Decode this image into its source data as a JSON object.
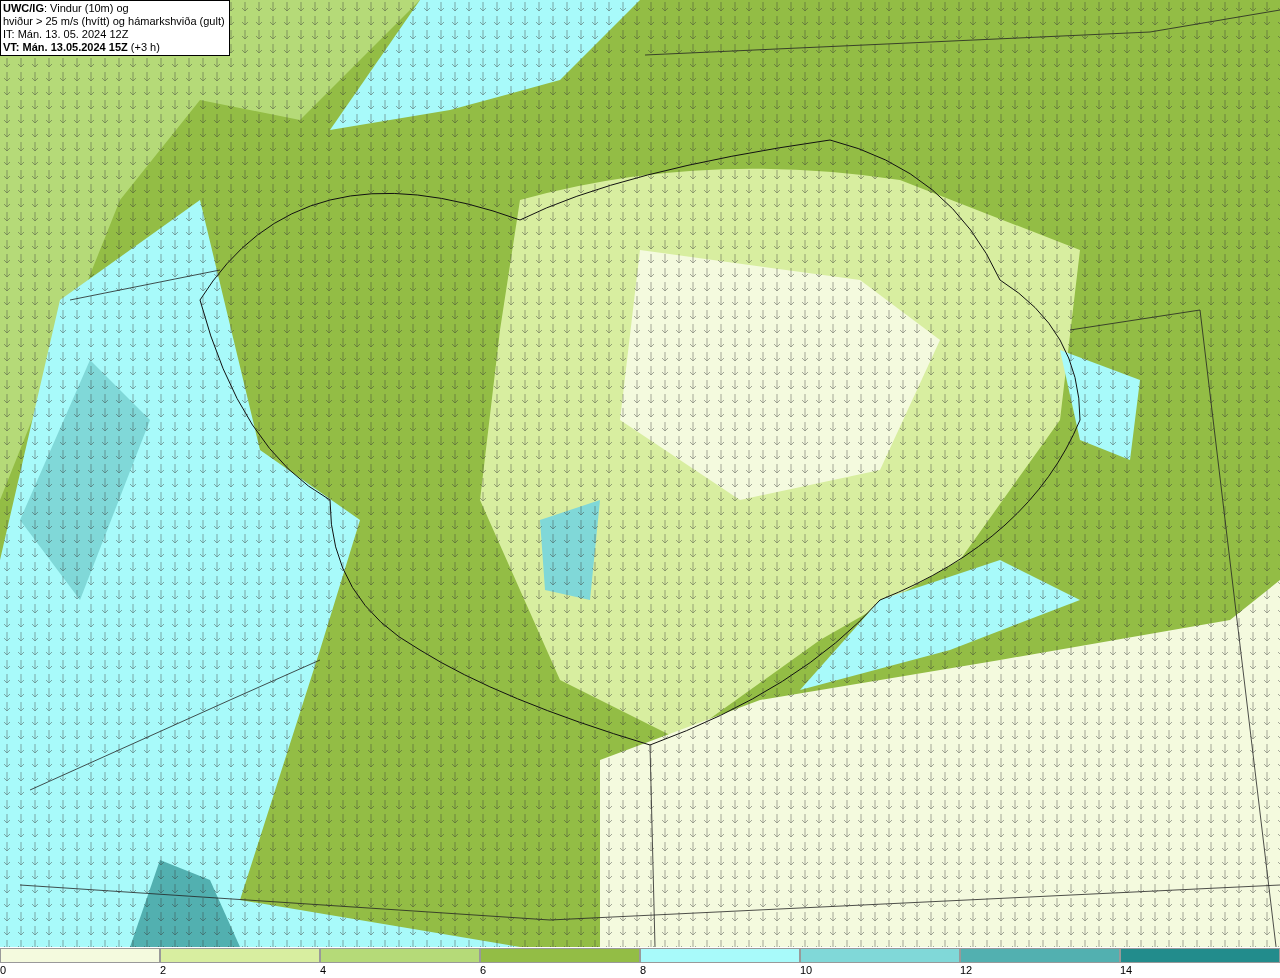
{
  "title_box": {
    "lines": [
      "**UWC/IG**: Vindur (10m) og",
      "hviður > 25 m/s (hvítt) og hámarkshviða (gult)",
      "IT: Mán. 13. 05. 2024 12Z",
      "**VT: Mán. 13.05.2024 15Z** (+3 h)"
    ]
  },
  "legend": {
    "items": [
      {
        "label": "0",
        "color": "#f4fade"
      },
      {
        "label": "2",
        "color": "#d8eea0"
      },
      {
        "label": "4",
        "color": "#b5da78"
      },
      {
        "label": "6",
        "color": "#93bd45"
      },
      {
        "label": "8",
        "color": "#a8fafa"
      },
      {
        "label": "10",
        "color": "#80d8d8"
      },
      {
        "label": "12",
        "color": "#52b0b0"
      },
      {
        "label": "14",
        "color": "#228c8c"
      }
    ]
  }
}
